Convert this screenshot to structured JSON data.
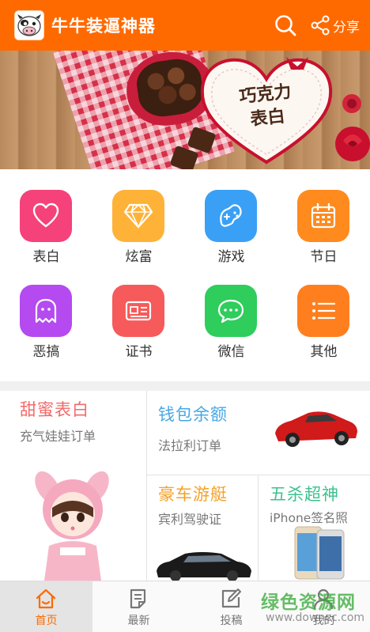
{
  "header": {
    "title": "牛牛装逼神器",
    "share_label": "分享"
  },
  "banner": {
    "line1": "巧克力",
    "line2": "表白"
  },
  "grid": [
    {
      "label": "表白",
      "icon": "heart-icon",
      "color": "#f5427a"
    },
    {
      "label": "炫富",
      "icon": "diamond-icon",
      "color": "#ffb238"
    },
    {
      "label": "游戏",
      "icon": "gamepad-icon",
      "color": "#3aa0f5"
    },
    {
      "label": "节日",
      "icon": "calendar-icon",
      "color": "#ff8a1e"
    },
    {
      "label": "恶搞",
      "icon": "ghost-icon",
      "color": "#b44af0"
    },
    {
      "label": "证书",
      "icon": "certificate-icon",
      "color": "#f65a5a"
    },
    {
      "label": "微信",
      "icon": "chat-icon",
      "color": "#2fcd5c"
    },
    {
      "label": "其他",
      "icon": "list-icon",
      "color": "#ff7f1e"
    }
  ],
  "promo": {
    "sweet": {
      "title": "甜蜜表白",
      "subtitle": "充气娃娃订单",
      "color": "#f26a6a"
    },
    "wallet": {
      "title": "钱包余额",
      "subtitle": "法拉利订单",
      "color": "#46a8e6"
    },
    "luxury": {
      "title": "豪车游艇",
      "subtitle": "宾利驾驶证",
      "color": "#f3a22a"
    },
    "pentakill": {
      "title": "五杀超神",
      "subtitle": "iPhone签名照",
      "color": "#3cc28e"
    }
  },
  "nav": [
    {
      "label": "首页",
      "icon": "home-icon"
    },
    {
      "label": "最新",
      "icon": "document-icon"
    },
    {
      "label": "投稿",
      "icon": "edit-icon"
    },
    {
      "label": "我的",
      "icon": "user-icon"
    }
  ],
  "watermark": {
    "title": "绿色资源网",
    "url": "www.downcc.com"
  },
  "colors": {
    "accent": "#ff6a00"
  }
}
